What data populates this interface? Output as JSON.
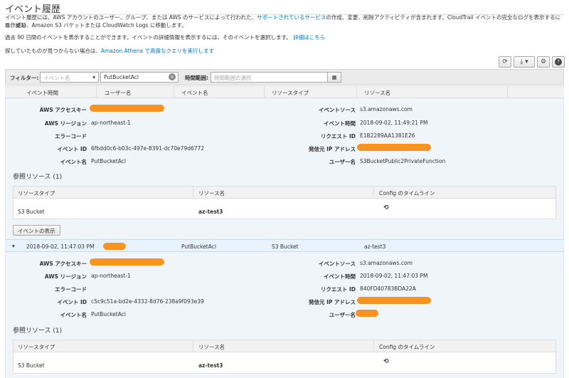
{
  "page": {
    "title": "イベント履歴",
    "intro_line1_a": "イベント履歴には、AWS アカウントのユーザー、グループ、または AWS のサービスによって行われた、",
    "intro_line1_link": "サポートされているサービス",
    "intro_line1_b": "の作成、変更、削除アクティビティが含まれます。CloudTrail イベントの完全なログを表示するには、証跡",
    "intro_line2": "を作成し、Amazon S3 バケットまたは CloudWatch Logs に移動します。",
    "intro_line3_a": "過去 90 日間のイベントを表示することができます。イベントの詳細情報を表示するには、そのイベントを選択します。",
    "intro_line3_link": "詳細はこちら",
    "intro_line4_a": "探していたものが見つからない場合は、",
    "intro_line4_link": "Amazon Athena で高度なクエリを実行します"
  },
  "toolbar": {
    "refresh_icon": "refresh-icon",
    "download_icon": "download-icon",
    "settings_icon": "gear-icon",
    "help_icon": "help-icon"
  },
  "filter": {
    "label": "フィルター:",
    "attribute_placeholder": "イベント名",
    "value": "PutBucketAcl",
    "time_label": "時間範囲:",
    "time_placeholder": "時間範囲の選択"
  },
  "columns": [
    "イベント時間",
    "ユーザー名",
    "イベント名",
    "リソースタイプ",
    "リソース名"
  ],
  "labels": {
    "access_key": "AWS アクセスキー",
    "region": "AWS リージョン",
    "error_code": "エラーコード",
    "event_id": "イベント ID",
    "event_name": "イベント名",
    "event_source": "イベントソース",
    "event_time": "イベント時間",
    "request_id": "リクエスト ID",
    "source_ip": "発信元 IP アドレス",
    "user_name": "ユーザー名",
    "ref_resources": "参照リソース (1)",
    "rt_type": "リソースタイプ",
    "rt_name": "リソース名",
    "rt_timeline": "Config のタイムライン",
    "view_event": "イベントの表示"
  },
  "event1": {
    "region": "ap-northeast-1",
    "event_id": "6fbdd0c6-b03c-497e-8391-dc70e79d6772",
    "event_name": "PutBucketAcl",
    "event_source": "s3.amazonaws.com",
    "event_time": "2018-09-02, 11:49:21 PM",
    "request_id": "E1B2289AA1381E26",
    "user_name": "S3BucketPublic2PrivateFunction",
    "resource_type": "S3 Bucket",
    "resource_name": "az-test3"
  },
  "event2": {
    "time": "2018-09-02, 11:47:03 PM",
    "event_name": "PutBucketAcl",
    "resource_type": "S3 Bucket",
    "resource_name": "az-test3",
    "region": "ap-northeast-1",
    "event_id": "c5c9c51a-bd2e-4332-8d76-238a9f093e39",
    "event_source": "s3.amazonaws.com",
    "event_time": "2018-09-02, 11:47:03 PM",
    "request_id": "840FD40783BDA22A"
  },
  "colors": {
    "redaction": "#f7931e",
    "link": "#0073bb",
    "panel_bg": "#f0f5fa"
  }
}
